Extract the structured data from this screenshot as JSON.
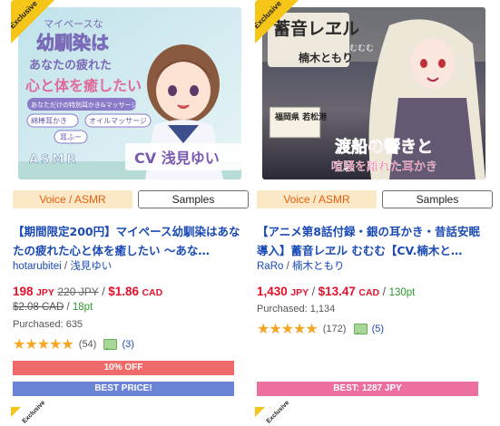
{
  "cards": [
    {
      "exclusive": "Exclusive",
      "genre": "Voice / ASMR",
      "samples": "Samples",
      "title": "【期間限定200円】マイペース幼馴染はあなたの疲れた心と体を癒したい ～あな…",
      "circle": "hotarubitei",
      "cv": "浅見ゆい",
      "price_jpy": "198",
      "unit_jpy": "JPY",
      "old_price_jpy": "220 JPY",
      "price_cad": "$1.86",
      "unit_cad": "CAD",
      "old_price_cad": "$2.08 CAD",
      "points": "18pt",
      "purchased": "Purchased: 635",
      "stars": "★★★★★",
      "rating_count": "(54)",
      "comment_count": "(3)",
      "discount": "10% OFF",
      "best": "BEST PRICE!",
      "art": {
        "title_lines": [
          "マイペースな",
          "幼馴染は",
          "あなたの疲れた",
          "心と体を癒したい"
        ],
        "subtitle": "あなただけの特別耳かき&マッサージ",
        "chips": [
          "綿棒耳かき",
          "オイルマッサージ",
          "耳ふー"
        ],
        "asmr": "ASMR",
        "cv": "CV 浅見ゆい"
      }
    },
    {
      "exclusive": "Exclusive",
      "genre": "Voice / ASMR",
      "samples": "Samples",
      "title": "【アニメ第8話付録・銀の耳かき・昔話安眠導入】蓄音レヱル むむむ【CV.楠木と…",
      "circle": "RaRo",
      "cv": "楠木ともり",
      "price_jpy": "1,430",
      "unit_jpy": "JPY",
      "price_cad": "$13.47",
      "unit_cad": "CAD",
      "points": "130pt",
      "purchased": "Purchased: 1,134",
      "stars": "★★★★★",
      "rating_count": "(172)",
      "comment_count": "(5)",
      "best": "BEST: 1287 JPY",
      "art": {
        "title": "蓄音レヱル",
        "name": "むむむ",
        "name_jp": "楠木ともり",
        "station": "福岡県 若松港",
        "tagline": "渡船の響きと",
        "tagline2": "喧騒を離れた耳かき"
      }
    }
  ],
  "colors": {
    "link": "#1a4ab5",
    "price_red": "#e3102a",
    "points_green": "#2b9a2b",
    "genre_bg": "#fbe8c6",
    "genre_text": "#e6600f",
    "off_bar": "#ef6b6b",
    "best_bar_blue": "#6b84d6",
    "best_bar_pink": "#ec6fa0",
    "ribbon": "#f5c518"
  },
  "next_row_ribbons": [
    "Exclusive",
    "Exclusive"
  ]
}
